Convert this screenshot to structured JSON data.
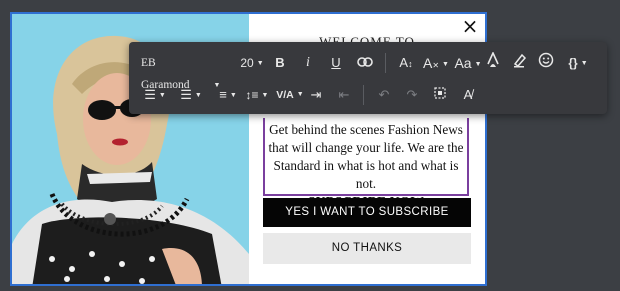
{
  "popup": {
    "welcome_text": "WELCOME TO",
    "close_symbol": "×",
    "body_text": "Get behind the scenes Fashion News that will change your life. We are the Standard in what is hot and what is not.",
    "subscribe_heading": "SUBSCRIBE NOW",
    "yes_button": "YES I WANT TO SUBSCRIBE",
    "no_button": "NO THANKS"
  },
  "toolbar": {
    "font_family": "EB Garamond",
    "font_size": "20",
    "bold_label": "B",
    "italic_label": "i",
    "underline_label": "U",
    "size_aa_label": "A",
    "font_case_label": "Aa",
    "variables_label": "{}",
    "vertical_align_label": "V/A",
    "icons": [
      "link-icon",
      "text-size-icon",
      "clear-format-icon",
      "font-color-icon",
      "highlight-icon",
      "emoji-icon",
      "ordered-list-icon",
      "unordered-list-icon",
      "align-icon",
      "line-height-icon",
      "indent-icon",
      "outdent-icon",
      "undo-icon",
      "redo-icon",
      "select-all-icon",
      "remove-format-icon"
    ]
  },
  "colors": {
    "accent_border": "#2f6fd1",
    "textbox_border": "#7a3f9e",
    "toolbar_bg": "#38393d",
    "yes_button_bg": "#050505",
    "no_button_bg": "#e9e9e9"
  }
}
